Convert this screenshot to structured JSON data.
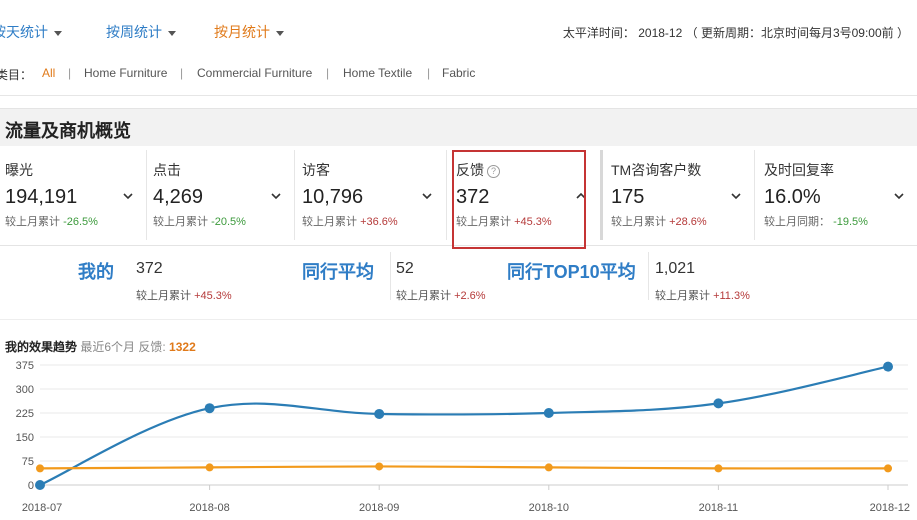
{
  "top_tabs": [
    {
      "label": "按天统计",
      "active": false
    },
    {
      "label": "按周统计",
      "active": false
    },
    {
      "label": "按月统计",
      "active": true
    }
  ],
  "time_info": "太平洋时间： 2018-12 （ 更新周期：北京时间每月3号09:00前 ）",
  "category": {
    "label": "类目：",
    "items": [
      "All",
      "Home Furniture",
      "Commercial Furniture",
      "Home Textile",
      "Fabric"
    ],
    "separator": "|",
    "active": "All"
  },
  "section_title": "流量及商机概览",
  "metrics": [
    {
      "label": "曝光",
      "value": "194,191",
      "change_label": "较上月累计",
      "change": "-26.5%",
      "trend": "down",
      "expanded": false
    },
    {
      "label": "点击",
      "value": "4,269",
      "change_label": "较上月累计",
      "change": "-20.5%",
      "trend": "down",
      "expanded": false
    },
    {
      "label": "访客",
      "value": "10,796",
      "change_label": "较上月累计",
      "change": "+36.6%",
      "trend": "up",
      "expanded": false
    },
    {
      "label": "反馈",
      "value": "372",
      "change_label": "较上月累计",
      "change": "+45.3%",
      "trend": "up",
      "expanded": true,
      "help": "?"
    },
    {
      "label": "TM咨询客户数",
      "value": "175",
      "change_label": "较上月累计",
      "change": "+28.6%",
      "trend": "up",
      "expanded": false
    },
    {
      "label": "及时回复率",
      "value": "16.0%",
      "change_label": "较上月同期：",
      "change": "-19.5%",
      "trend": "down",
      "expanded": false
    }
  ],
  "comparison": [
    {
      "title": "我的",
      "value": "372",
      "change_label": "较上月累计",
      "change": "+45.3%"
    },
    {
      "title": "同行平均",
      "value": "52",
      "change_label": "较上月累计",
      "change": "+2.6%"
    },
    {
      "title": "同行TOP10平均",
      "value": "1,021",
      "change_label": "较上月累计",
      "change": "+11.3%"
    }
  ],
  "chart_header": {
    "title": "我的效果趋势",
    "subtitle": "最近6个月 反馈:",
    "total": "1322"
  },
  "colors": {
    "blue": "#2f7dc6",
    "orange": "#f29a1c",
    "accent": "#e07a1a",
    "up": "#b53a3a",
    "down": "#3c9a3c",
    "highlight": "#c53434"
  },
  "chart_data": {
    "type": "line",
    "categories": [
      "2018-07",
      "2018-08",
      "2018-09",
      "2018-10",
      "2018-11",
      "2018-12"
    ],
    "yticks": [
      0,
      75,
      150,
      225,
      300,
      375
    ],
    "ylim": [
      0,
      375
    ],
    "grid": true,
    "series": [
      {
        "values": [
          0,
          240,
          222,
          225,
          255,
          370
        ],
        "color": "#2b7db5",
        "markers": true
      },
      {
        "values": [
          52,
          55,
          58,
          55,
          52,
          52
        ],
        "color": "#f29a1c",
        "markers": false
      }
    ]
  }
}
